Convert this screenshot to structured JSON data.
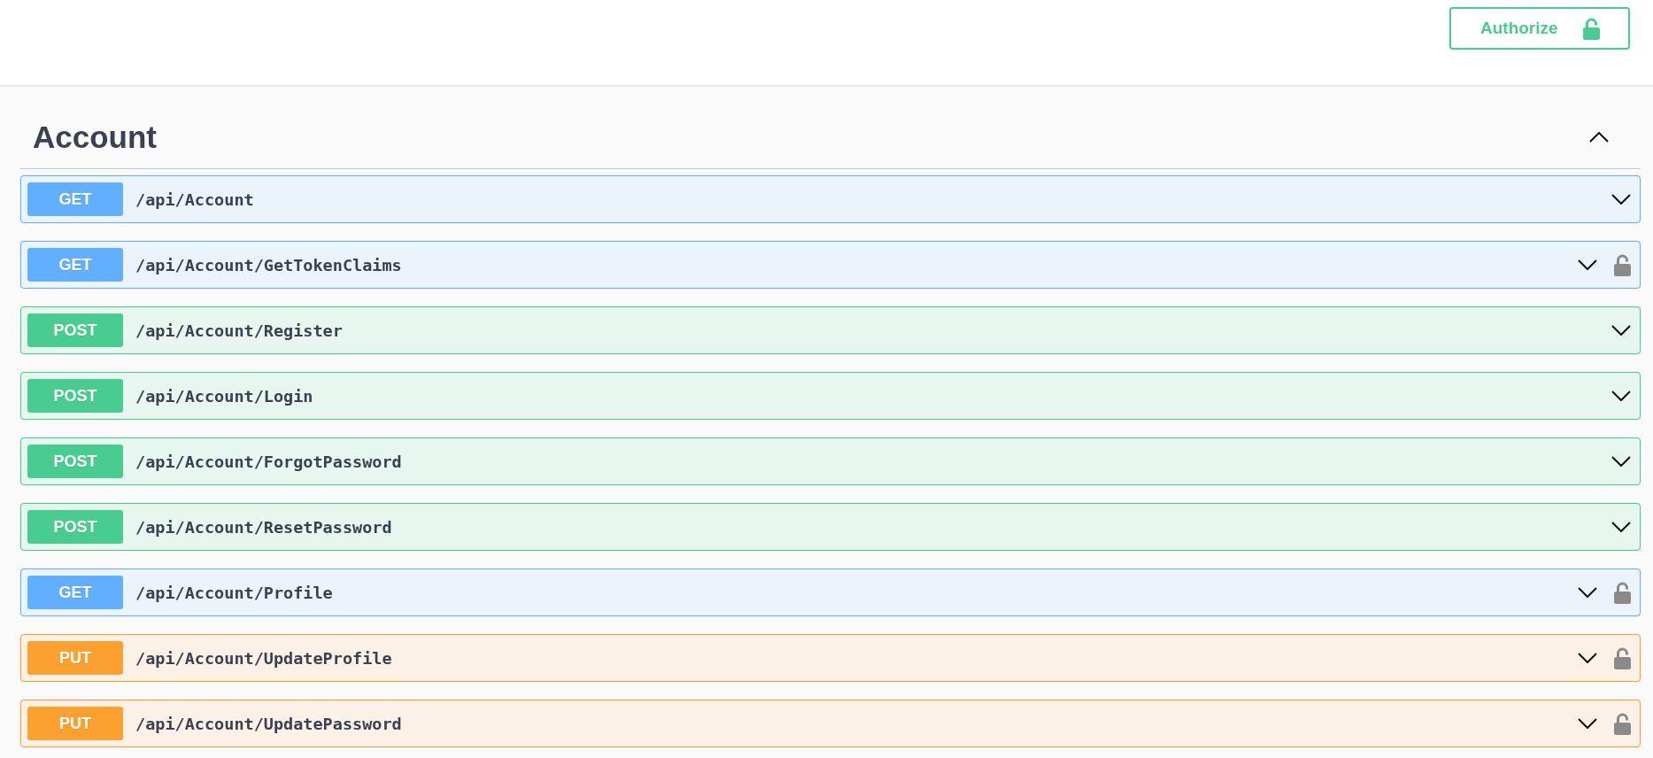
{
  "header": {
    "authorize_button": {
      "label": "Authorize"
    }
  },
  "section": {
    "title": "Account",
    "expanded": true,
    "operations": [
      {
        "kind": "get",
        "method": "GET",
        "path": "/api/Account",
        "secured": false,
        "expanded": false
      },
      {
        "kind": "get",
        "method": "GET",
        "path": "/api/Account/GetTokenClaims",
        "secured": true,
        "expanded": false
      },
      {
        "kind": "post",
        "method": "POST",
        "path": "/api/Account/Register",
        "secured": false,
        "expanded": false
      },
      {
        "kind": "post",
        "method": "POST",
        "path": "/api/Account/Login",
        "secured": false,
        "expanded": false
      },
      {
        "kind": "post",
        "method": "POST",
        "path": "/api/Account/ForgotPassword",
        "secured": false,
        "expanded": false
      },
      {
        "kind": "post",
        "method": "POST",
        "path": "/api/Account/ResetPassword",
        "secured": false,
        "expanded": false
      },
      {
        "kind": "get",
        "method": "GET",
        "path": "/api/Account/Profile",
        "secured": true,
        "expanded": false
      },
      {
        "kind": "put",
        "method": "PUT",
        "path": "/api/Account/UpdateProfile",
        "secured": true,
        "expanded": false
      },
      {
        "kind": "put",
        "method": "PUT",
        "path": "/api/Account/UpdatePassword",
        "secured": true,
        "expanded": false
      }
    ]
  }
}
